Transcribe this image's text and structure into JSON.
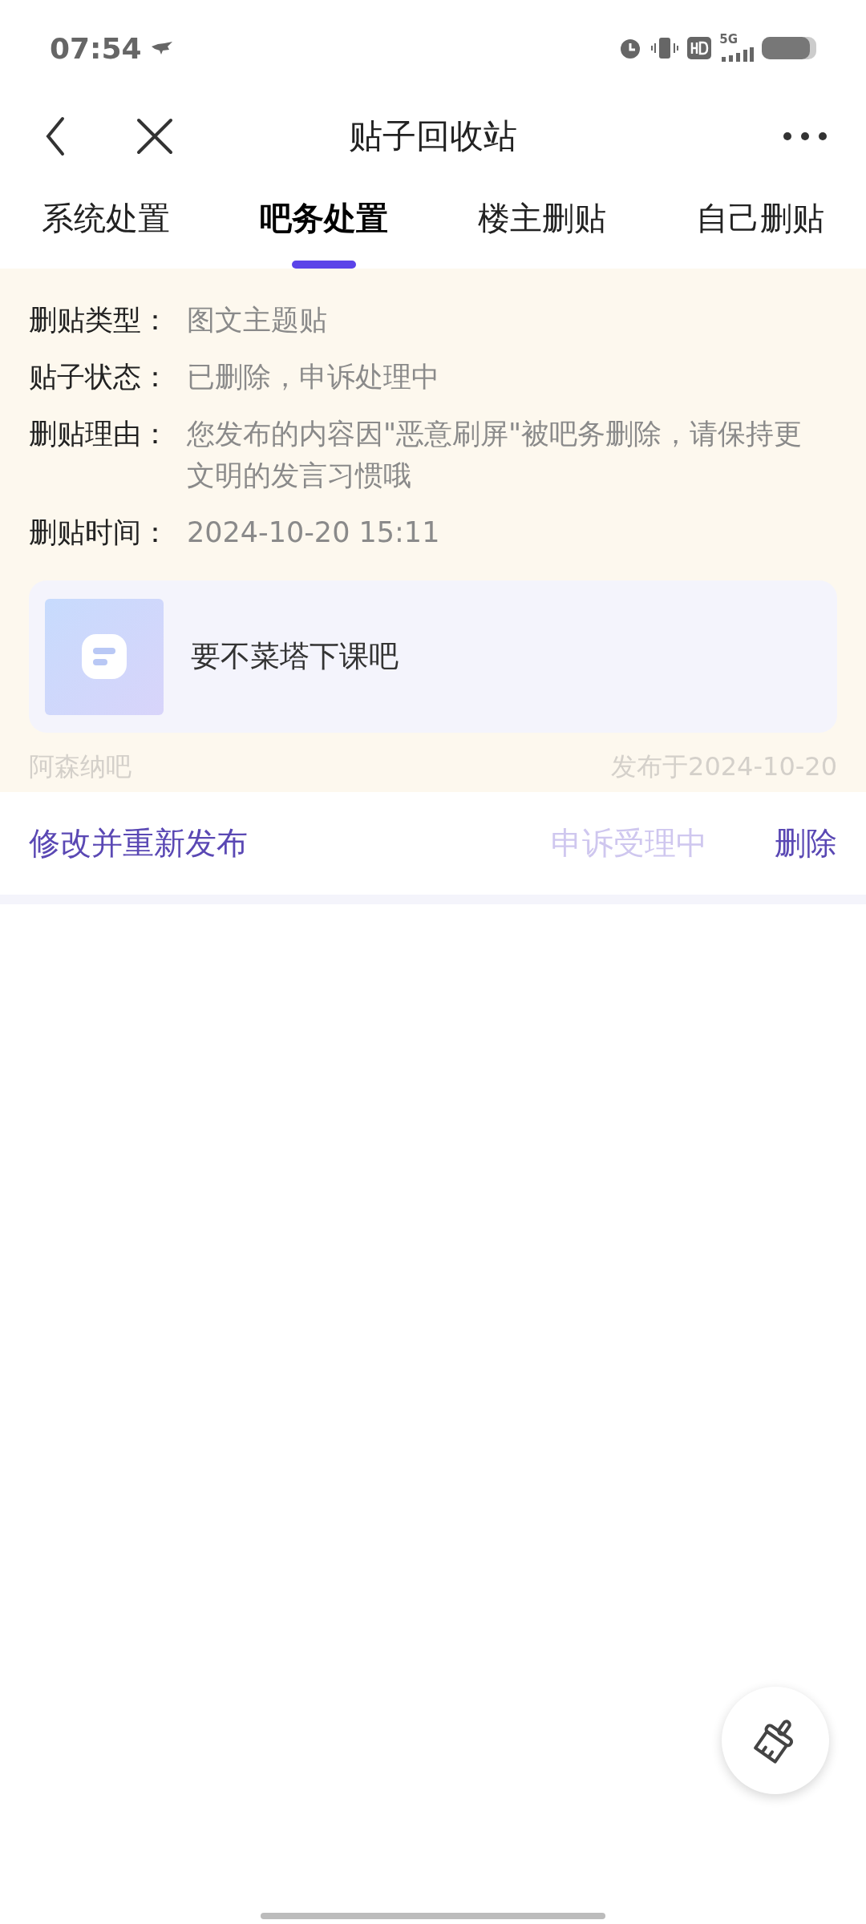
{
  "status_bar": {
    "time": "07:54",
    "network": "5G"
  },
  "nav": {
    "title": "贴子回收站"
  },
  "tabs": [
    {
      "label": "系统处置",
      "selected": false
    },
    {
      "label": "吧务处置",
      "selected": true
    },
    {
      "label": "楼主删贴",
      "selected": false
    },
    {
      "label": "自己删贴",
      "selected": false
    }
  ],
  "details": [
    {
      "label": "删贴类型：",
      "value": "图文主题贴"
    },
    {
      "label": "贴子状态：",
      "value": "已删除，申诉处理中"
    },
    {
      "label": "删贴理由：",
      "value": "您发布的内容因\"恶意刷屏\"被吧务删除，请保持更文明的发言习惯哦"
    },
    {
      "label": "删贴时间：",
      "value": "2024-10-20 15:11"
    }
  ],
  "post": {
    "title": "要不菜塔下课吧"
  },
  "forum": "阿森纳吧",
  "published": "发布于2024-10-20",
  "actions": [
    {
      "label": "修改并重新发布",
      "disabled": false
    },
    {
      "label": "申诉受理中",
      "disabled": true
    },
    {
      "label": "删除",
      "disabled": false
    }
  ]
}
